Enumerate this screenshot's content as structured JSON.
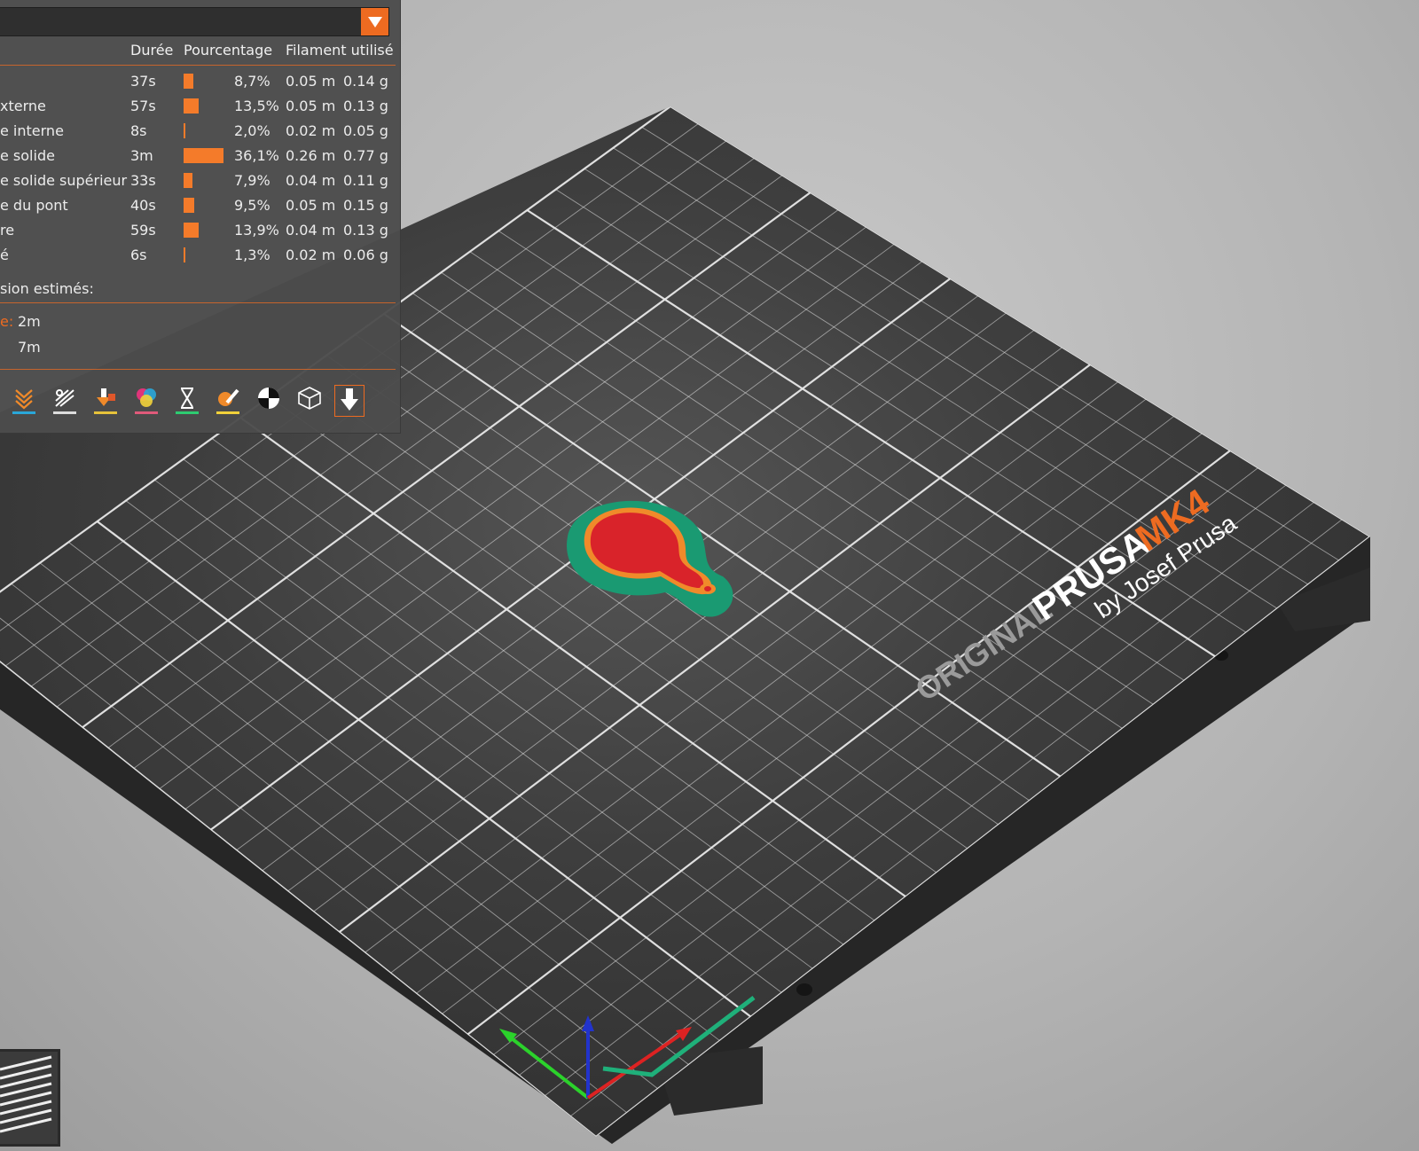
{
  "legend": {
    "headers": {
      "duration": "Durée",
      "percentage": "Pourcentage",
      "filament": "Filament utilisé"
    },
    "rows": [
      {
        "name": "",
        "duration": "37s",
        "percent": "8,7%",
        "pct_value": 8.7,
        "length": "0.05 m",
        "weight": "0.14 g"
      },
      {
        "name": "xterne",
        "duration": "57s",
        "percent": "13,5%",
        "pct_value": 13.5,
        "length": "0.05 m",
        "weight": "0.13 g"
      },
      {
        "name": "e interne",
        "duration": "8s",
        "percent": "2,0%",
        "pct_value": 2.0,
        "length": "0.02 m",
        "weight": "0.05 g"
      },
      {
        "name": "e solide",
        "duration": "3m",
        "percent": "36,1%",
        "pct_value": 36.1,
        "length": "0.26 m",
        "weight": "0.77 g"
      },
      {
        "name": "e solide supérieur",
        "duration": "33s",
        "percent": "7,9%",
        "pct_value": 7.9,
        "length": "0.04 m",
        "weight": "0.11 g"
      },
      {
        "name": "e du pont",
        "duration": "40s",
        "percent": "9,5%",
        "pct_value": 9.5,
        "length": "0.05 m",
        "weight": "0.15 g"
      },
      {
        "name": "re",
        "duration": "59s",
        "percent": "13,9%",
        "pct_value": 13.9,
        "length": "0.04 m",
        "weight": "0.13 g"
      },
      {
        "name": "é",
        "duration": "6s",
        "percent": "1,3%",
        "pct_value": 1.3,
        "length": "0.02 m",
        "weight": "0.06 g"
      }
    ],
    "estimated_title": "sion estimés:",
    "estimates": [
      {
        "label": "e:",
        "value": "2m"
      },
      {
        "label": "",
        "value": "7m"
      }
    ],
    "toolbar_icons": [
      "travel-icon",
      "wipe-icon",
      "retractions-icon",
      "color-changes-icon",
      "pause-icon",
      "custom-gcode-icon",
      "center-of-gravity-icon",
      "shells-icon",
      "tool-marker-icon"
    ]
  },
  "bed": {
    "brand_original": "ORIGINAL",
    "brand_prusa": "PRUSA",
    "brand_model": "MK4",
    "brand_by": "by Josef Prusa"
  },
  "colors": {
    "accent": "#ed6b21",
    "bar": "#f47b2a",
    "panel": "#4c4c4c",
    "bed": "#383838",
    "grid": "#e8e8e8",
    "part_red": "#d9232a",
    "part_outline": "#f08a2a",
    "part_skirt": "#1a9a72"
  }
}
